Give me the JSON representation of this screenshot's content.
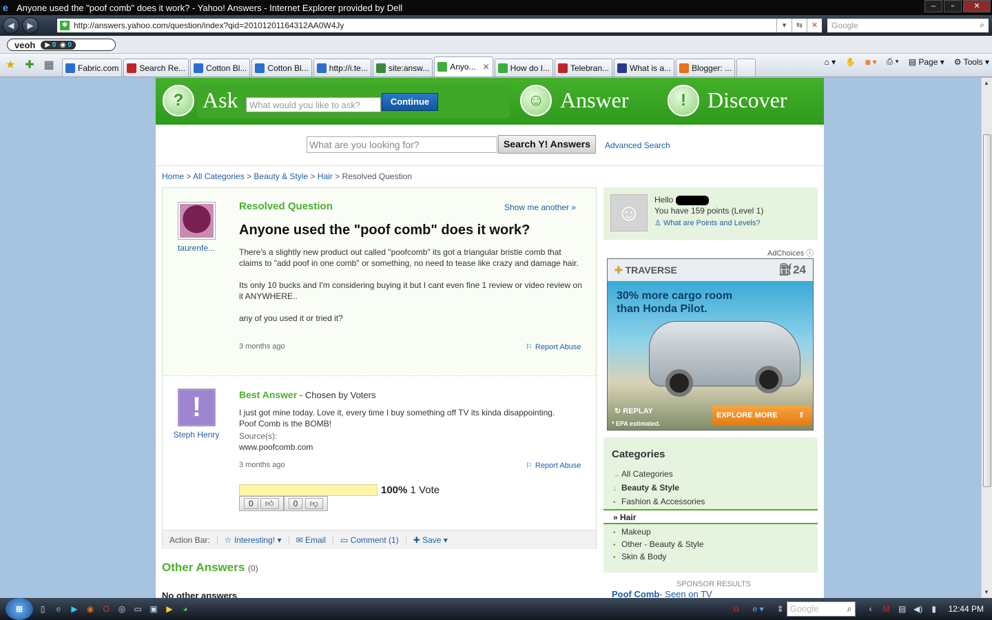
{
  "window": {
    "title": "Anyone used the \"poof comb\" does it work? - Yahoo! Answers - Internet Explorer provided by Dell"
  },
  "browser": {
    "url": "http://answers.yahoo.com/question/index?qid=20101201164312AA0W4Jy",
    "search_placeholder": "Google",
    "veoh": {
      "logo": "veoh",
      "videos": "0",
      "feeds": "0"
    },
    "tabs": [
      {
        "label": "Fabric.com",
        "color": "#2a6fcf",
        "icon": "ie-icon"
      },
      {
        "label": "Search Re...",
        "color": "#c0242b",
        "icon": "stop-icon"
      },
      {
        "label": "Cotton Bl...",
        "color": "#2a6fcf",
        "icon": "ie-icon"
      },
      {
        "label": "Cotton Bl...",
        "color": "#2a6fcf",
        "icon": "ie-icon"
      },
      {
        "label": "http://i.te...",
        "color": "#2a6fcf",
        "icon": "ie-icon"
      },
      {
        "label": "site:answ...",
        "color": "#3a8a3a",
        "icon": "google-icon"
      },
      {
        "label": "Anyo...",
        "color": "#3cae3c",
        "icon": "yahoo-answers-icon",
        "active": true
      },
      {
        "label": "How do I...",
        "color": "#3cae3c",
        "icon": "yahoo-answers-icon"
      },
      {
        "label": "Telebran...",
        "color": "#c0242b",
        "icon": "pi-icon"
      },
      {
        "label": "What is a...",
        "color": "#2a3a8a",
        "icon": "eye-icon"
      },
      {
        "label": "Blogger: ...",
        "color": "#e8701a",
        "icon": "blogger-icon"
      }
    ],
    "commands": {
      "page": "Page",
      "tools": "Tools"
    }
  },
  "header": {
    "ask": "Ask",
    "ask_placeholder": "What would you like to ask?",
    "continue": "Continue",
    "answer": "Answer",
    "discover": "Discover",
    "search_placeholder": "What are you looking for?",
    "search_button": "Search Y! Answers",
    "advanced": "Advanced Search"
  },
  "breadcrumb": [
    "Home",
    "All Categories",
    "Beauty & Style",
    "Hair",
    "Resolved Question"
  ],
  "question": {
    "status": "Resolved Question",
    "show_another": "Show me another »",
    "asker": "taurenfe...",
    "title": "Anyone used the \"poof comb\" does it work?",
    "p1": "There's a slightly new product out called \"poofcomb\" its got a triangular bristle comb that claims to \"add poof in one comb\" or something, no need to tease like crazy and damage hair.",
    "p2": "Its only 10 bucks and I'm considering buying it but I cant even fine 1 review or video review on it ANYWHERE..",
    "p3": "any of you used it or tried it?",
    "time": "3 months ago",
    "report": "Report Abuse"
  },
  "best_answer": {
    "label": "Best Answer",
    "chosen": "- Chosen by Voters",
    "user": "Steph Henry",
    "text": "I just got mine today. Love it, every time I buy something off TV its kinda disappointing. Poof Comb is the BOMB!",
    "sources_label": "Source(s):",
    "source": "www.poofcomb.com",
    "time": "3 months ago",
    "report": "Report Abuse",
    "vote_pct": "100%",
    "vote_fraction": 1.0,
    "votes": "1 Vote",
    "thumbs_up": "0",
    "thumbs_down": "0"
  },
  "action_bar": {
    "label": "Action Bar:",
    "interesting": "Interesting!",
    "email": "Email",
    "comment": "Comment (1)",
    "save": "Save"
  },
  "other_answers": {
    "title": "Other Answers",
    "count": "(0)",
    "none": "No other answers"
  },
  "user_box": {
    "hello": "Hello",
    "points": "You have 159 points (Level 1)",
    "link": "What are Points and Levels?"
  },
  "ad": {
    "adchoices": "AdChoices",
    "brand": "TRAVERSE",
    "mpg": "24",
    "headline": "30% more cargo room than Honda Pilot.",
    "replay": "REPLAY",
    "epa": "* EPA estimated.",
    "cta": "EXPLORE MORE"
  },
  "categories": {
    "title": "Categories",
    "all": "All Categories",
    "beauty": "Beauty & Style",
    "fashion": "Fashion & Accessories",
    "hair": "Hair",
    "makeup": "Makeup",
    "other": "Other - Beauty & Style",
    "skin": "Skin & Body"
  },
  "sponsor": {
    "label": "SPONSOR RESULTS",
    "link": "Poof Comb",
    "link_tail": "- Seen on TV"
  },
  "taskbar": {
    "clock": "12:44 PM",
    "search": "Google"
  }
}
